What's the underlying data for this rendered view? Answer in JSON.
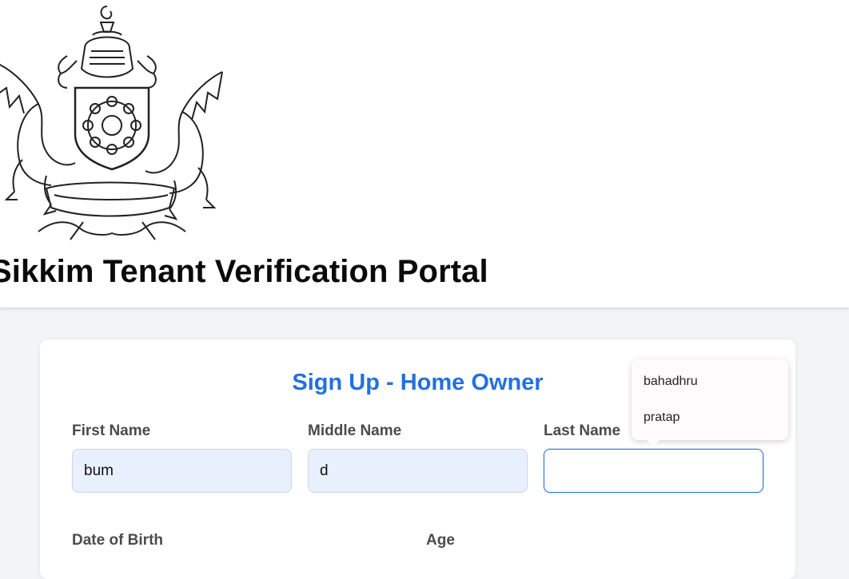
{
  "header": {
    "title": "Sikkim Tenant Verification Portal"
  },
  "form": {
    "title": "Sign Up - Home Owner",
    "first_name": {
      "label": "First Name",
      "value": "bum"
    },
    "middle_name": {
      "label": "Middle Name",
      "value": "d"
    },
    "last_name": {
      "label": "Last Name",
      "value": ""
    },
    "dob": {
      "label": "Date of Birth"
    },
    "age": {
      "label": "Age"
    }
  },
  "autocomplete": {
    "items": [
      "bahadhru",
      "pratap"
    ]
  },
  "colors": {
    "accent": "#2370e0",
    "autofill_bg": "#e8f0fe",
    "page_bg": "#f3f4f6"
  }
}
